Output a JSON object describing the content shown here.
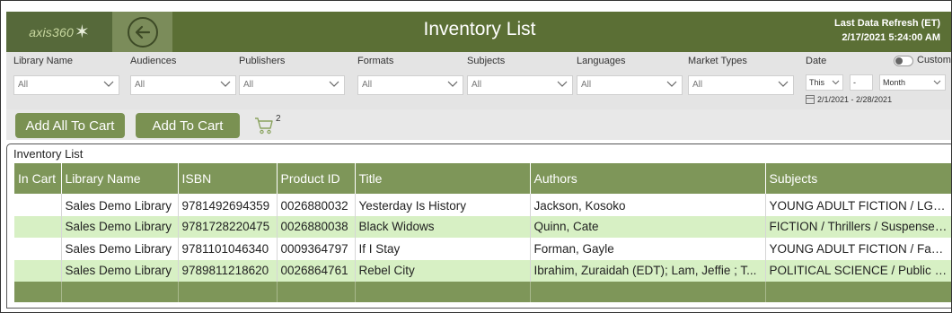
{
  "header": {
    "logo_text": "axis360",
    "title": "Inventory List",
    "refresh_label": "Last Data Refresh (ET)",
    "refresh_value": "2/17/2021 5:24:00 AM"
  },
  "filters": [
    {
      "label": "Library Name",
      "value": "All"
    },
    {
      "label": "Audiences",
      "value": "All"
    },
    {
      "label": "Publishers",
      "value": "All"
    },
    {
      "label": "Formats",
      "value": "All"
    },
    {
      "label": "Subjects",
      "value": "All"
    },
    {
      "label": "Languages",
      "value": "All"
    },
    {
      "label": "Market Types",
      "value": "All"
    }
  ],
  "date_filter": {
    "label": "Date",
    "custom_label": "Custom",
    "relative": "This",
    "count": "-",
    "unit": "Month",
    "range": "2/1/2021 - 2/28/2021"
  },
  "actions": {
    "add_all_label": "Add All To Cart",
    "add_label": "Add To Cart",
    "cart_count": "2"
  },
  "table": {
    "title": "Inventory List",
    "columns": [
      "In Cart",
      "Library Name",
      "ISBN",
      "Product ID",
      "Title",
      "Authors",
      "Subjects"
    ],
    "rows": [
      [
        "",
        "Sales Demo Library",
        "9781492694359",
        "0026880032",
        "Yesterday Is History",
        "Jackson, Kosoko",
        "YOUNG ADULT FICTION / LGBT; Y"
      ],
      [
        "",
        "Sales Demo Library",
        "9781728220475",
        "0026880038",
        "Black Widows",
        "Quinn, Cate",
        "FICTION / Thrillers / Suspense; FI"
      ],
      [
        "",
        "Sales Demo Library",
        "9781101046340",
        "0009364797",
        "If I Stay",
        "Forman, Gayle",
        "YOUNG ADULT FICTION / Family"
      ],
      [
        "",
        "Sales Demo Library",
        "9789811218620",
        "0026864761",
        "Rebel City",
        "Ibrahim, Zuraidah (EDT); Lam, Jeffie ; T...",
        "POLITICAL SCIENCE / Public Poli"
      ]
    ]
  },
  "colors": {
    "header_bg": "#5b6f35",
    "accent": "#7e9659",
    "alt_row": "#d7f0c4"
  }
}
